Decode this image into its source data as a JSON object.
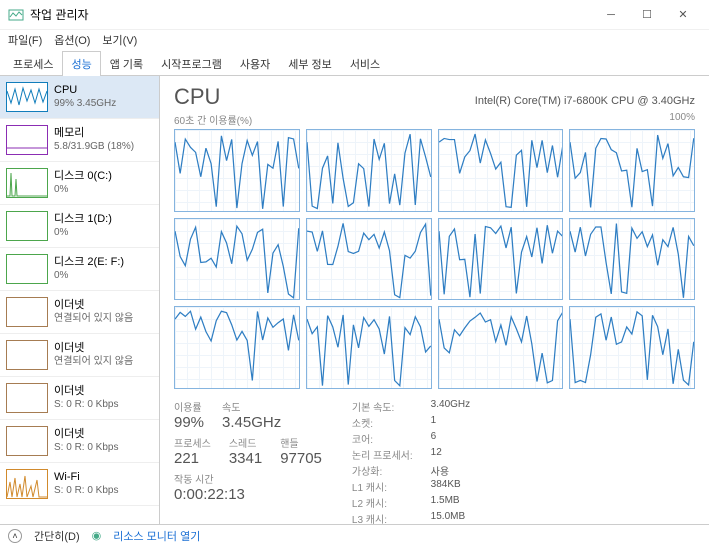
{
  "window": {
    "title": "작업 관리자"
  },
  "menu": {
    "file": "파일(F)",
    "options": "옵션(O)",
    "view": "보기(V)"
  },
  "tabs": [
    "프로세스",
    "성능",
    "앱 기록",
    "시작프로그램",
    "사용자",
    "세부 정보",
    "서비스"
  ],
  "active_tab": 1,
  "sidebar": [
    {
      "label": "CPU",
      "value": "99% 3.45GHz",
      "type": "cpu"
    },
    {
      "label": "메모리",
      "value": "5.8/31.9GB (18%)",
      "type": "mem"
    },
    {
      "label": "디스크 0(C:)",
      "value": "0%",
      "type": "disk"
    },
    {
      "label": "디스크 1(D:)",
      "value": "0%",
      "type": "disk"
    },
    {
      "label": "디스크 2(E: F:)",
      "value": "0%",
      "type": "disk"
    },
    {
      "label": "이더넷",
      "value": "연결되어 있지 않음",
      "type": "net"
    },
    {
      "label": "이더넷",
      "value": "연결되어 있지 않음",
      "type": "net"
    },
    {
      "label": "이더넷",
      "value": "S: 0 R: 0 Kbps",
      "type": "net"
    },
    {
      "label": "이더넷",
      "value": "S: 0 R: 0 Kbps",
      "type": "net"
    },
    {
      "label": "Wi-Fi",
      "value": "S: 0 R: 0 Kbps",
      "type": "wifi"
    }
  ],
  "main": {
    "title": "CPU",
    "cpu_name": "Intel(R) Core(TM) i7-6800K CPU @ 3.40GHz",
    "graph_label_left": "60초 간 이용률(%)",
    "graph_label_right": "100%"
  },
  "stats_left": {
    "row1": [
      {
        "label": "이용률",
        "value": "99%"
      },
      {
        "label": "속도",
        "value": "3.45GHz"
      }
    ],
    "row2": [
      {
        "label": "프로세스",
        "value": "221"
      },
      {
        "label": "스레드",
        "value": "3341"
      },
      {
        "label": "핸들",
        "value": "97705"
      }
    ],
    "uptime_label": "작동 시간",
    "uptime_value": "0:00:22:13"
  },
  "stats_right": [
    {
      "label": "기본 속도:",
      "value": "3.40GHz"
    },
    {
      "label": "소켓:",
      "value": "1"
    },
    {
      "label": "코어:",
      "value": "6"
    },
    {
      "label": "논리 프로세서:",
      "value": "12"
    },
    {
      "label": "가상화:",
      "value": "사용"
    },
    {
      "label": "L1 캐시:",
      "value": "384KB"
    },
    {
      "label": "L2 캐시:",
      "value": "1.5MB"
    },
    {
      "label": "L3 캐시:",
      "value": "15.0MB"
    }
  ],
  "statusbar": {
    "fewer": "간단히(D)",
    "resmon": "리소스 모니터 열기"
  },
  "chart_data": {
    "type": "line",
    "title": "CPU 이용률 (12 논리 프로세서)",
    "xlabel": "60초",
    "ylabel": "이용률",
    "ylim": [
      0,
      100
    ],
    "series_note": "12 small per-logical-processor utilization sparklines; each fluctuates roughly 10–100% with repeated dips and spikes; visual only, exact per-tick values not labeled"
  }
}
